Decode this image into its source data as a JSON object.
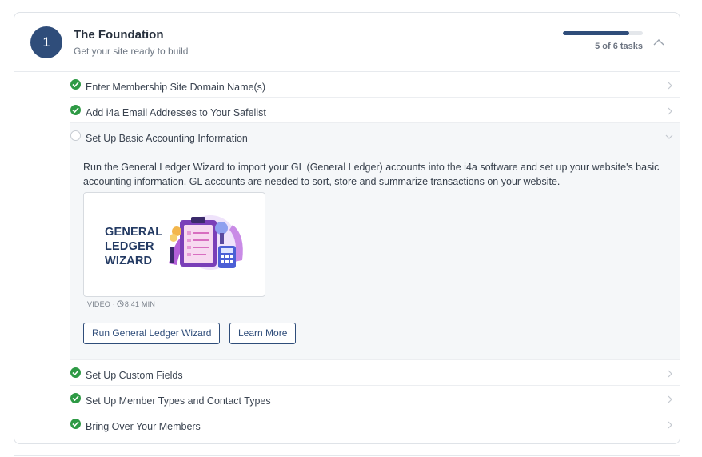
{
  "step": {
    "number": "1",
    "title": "The Foundation",
    "subtitle": "Get your site ready to build",
    "progress_text": "5 of 6 tasks",
    "progress_fraction": 0.833
  },
  "tasks_before": [
    {
      "label": "Enter Membership Site Domain Name(s)",
      "done": true
    },
    {
      "label": "Add i4a Email Addresses to Your Safelist",
      "done": true
    }
  ],
  "expanded_task": {
    "label": "Set Up Basic Accounting Information",
    "done": false,
    "description": "Run the General Ledger Wizard to import your GL (General Ledger) accounts into the i4a software and set up your website's basic accounting information. GL accounts are needed to sort, store and summarize transactions on your website.",
    "video": {
      "title_line1": "GENERAL",
      "title_line2": "LEDGER",
      "title_line3": "WIZARD",
      "meta_type": "VIDEO ·",
      "meta_duration": "8:41 MIN"
    },
    "primary_button": "Run General Ledger Wizard",
    "secondary_button": "Learn More"
  },
  "tasks_after": [
    {
      "label": "Set Up Custom Fields",
      "done": true
    },
    {
      "label": "Set Up Member Types and Contact Types",
      "done": true
    },
    {
      "label": "Bring Over Your Members",
      "done": true
    }
  ],
  "colors": {
    "accent": "#2f4d7a",
    "check_green": "#2e9a45"
  },
  "icons": {
    "collapse": "chevron-up-icon",
    "row": "chevron-right-icon",
    "expanded_row": "chevron-down-icon",
    "done": "check-circle-icon",
    "pending": "empty-circle-icon",
    "clock": "clock-icon"
  }
}
